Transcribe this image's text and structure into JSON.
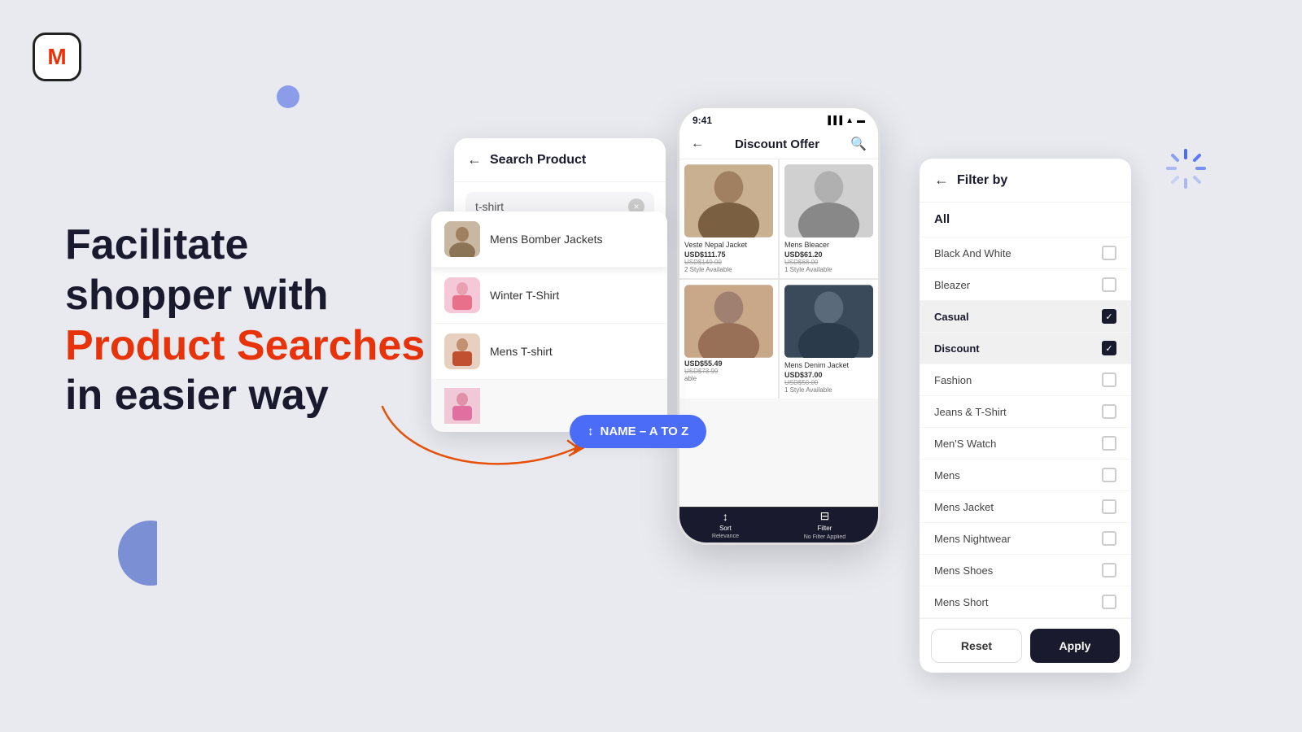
{
  "logo": {
    "letter": "M"
  },
  "hero": {
    "line1": "Facilitate",
    "line2": "shopper with",
    "highlight": "Product Searches",
    "line3": "in easier way"
  },
  "search_panel": {
    "title": "Search Product",
    "input_value": "t-shirt",
    "back_label": "←",
    "clear_label": "×"
  },
  "search_results": [
    {
      "label": "Mens Bomber Jackets",
      "active": true
    },
    {
      "label": "Winter T-Shirt",
      "active": false
    },
    {
      "label": "Mens T-shirt",
      "active": false
    }
  ],
  "sort_badge": {
    "label": "NAME – A TO Z",
    "icon": "↕"
  },
  "phone": {
    "time": "9:41",
    "title": "Discount Offer",
    "products": [
      {
        "name": "Veste Nepal Jacket",
        "price": "USD$111.75",
        "old_price": "USD$149.00",
        "availability": "2 Style Available"
      },
      {
        "name": "Mens Bleacer",
        "price": "USD$61.20",
        "old_price": "USD$68.00",
        "availability": "1 Style Available"
      },
      {
        "name": "",
        "price": "USD$55.49",
        "old_price": "USD$73.99",
        "availability": "able"
      },
      {
        "name": "Mens Denim Jacket",
        "price": "USD$37.00",
        "old_price": "USD$50.00",
        "availability": "1 Style Available"
      }
    ],
    "bottom_bar": [
      {
        "icon": "↕",
        "label": "Sort\nRelevance"
      },
      {
        "icon": "▽",
        "label": "Filter\nNo Filter Applied"
      }
    ]
  },
  "filter": {
    "title": "Filter by",
    "back_label": "←",
    "all_label": "All",
    "items": [
      {
        "label": "Black And White",
        "checked": false
      },
      {
        "label": "Bleazer",
        "checked": false
      },
      {
        "label": "Casual",
        "checked": true,
        "highlighted": true
      },
      {
        "label": "Discount",
        "checked": true,
        "highlighted": true
      },
      {
        "label": "Fashion",
        "checked": false
      },
      {
        "label": "Jeans & T-Shirt",
        "checked": false
      },
      {
        "label": "Men'S Watch",
        "checked": false
      },
      {
        "label": "Mens",
        "checked": false
      },
      {
        "label": "Mens Jacket",
        "checked": false
      },
      {
        "label": "Mens Nightwear",
        "checked": false
      },
      {
        "label": "Mens Shoes",
        "checked": false
      },
      {
        "label": "Mens Short",
        "checked": false
      }
    ],
    "reset_label": "Reset",
    "apply_label": "Apply"
  },
  "decorative": {
    "circle_top_color": "#8b9de8",
    "circle_bottom_color": "#7b8fd4",
    "spinner_color": "#5b7be8",
    "arrow_color": "#e8510a"
  }
}
